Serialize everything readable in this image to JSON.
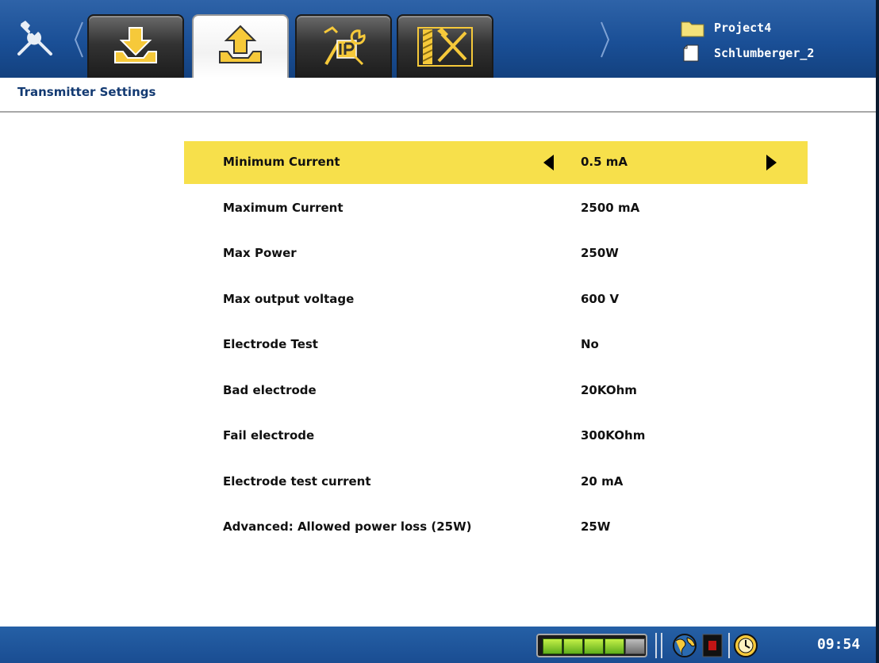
{
  "header": {
    "project_name": "Project4",
    "file_name": "Schlumberger_2",
    "tabs": [
      {
        "icon": "download-icon",
        "active": false
      },
      {
        "icon": "upload-icon",
        "active": true
      },
      {
        "icon": "ip-settings-icon",
        "active": false
      },
      {
        "icon": "hardware-tools-icon",
        "active": false
      }
    ]
  },
  "page": {
    "title": "Transmitter Settings"
  },
  "settings": [
    {
      "label": "Minimum Current",
      "value": "0.5 mA",
      "selected": true
    },
    {
      "label": "Maximum Current",
      "value": "2500 mA"
    },
    {
      "label": "Max Power",
      "value": "250W"
    },
    {
      "label": "Max output voltage",
      "value": "600 V"
    },
    {
      "label": "Electrode Test",
      "value": "No"
    },
    {
      "label": "Bad electrode",
      "value": "20KOhm"
    },
    {
      "label": "Fail electrode",
      "value": "300KOhm"
    },
    {
      "label": "Electrode test current",
      "value": "20 mA"
    },
    {
      "label": "Advanced: Allowed power loss (25W)",
      "value": "25W"
    }
  ],
  "status": {
    "time": "09:54",
    "battery_cells_filled": 4,
    "battery_cells_total": 5
  },
  "colors": {
    "header_blue": "#1a4f96",
    "selection_yellow": "#f7e04b",
    "title_text": "#133a72"
  }
}
